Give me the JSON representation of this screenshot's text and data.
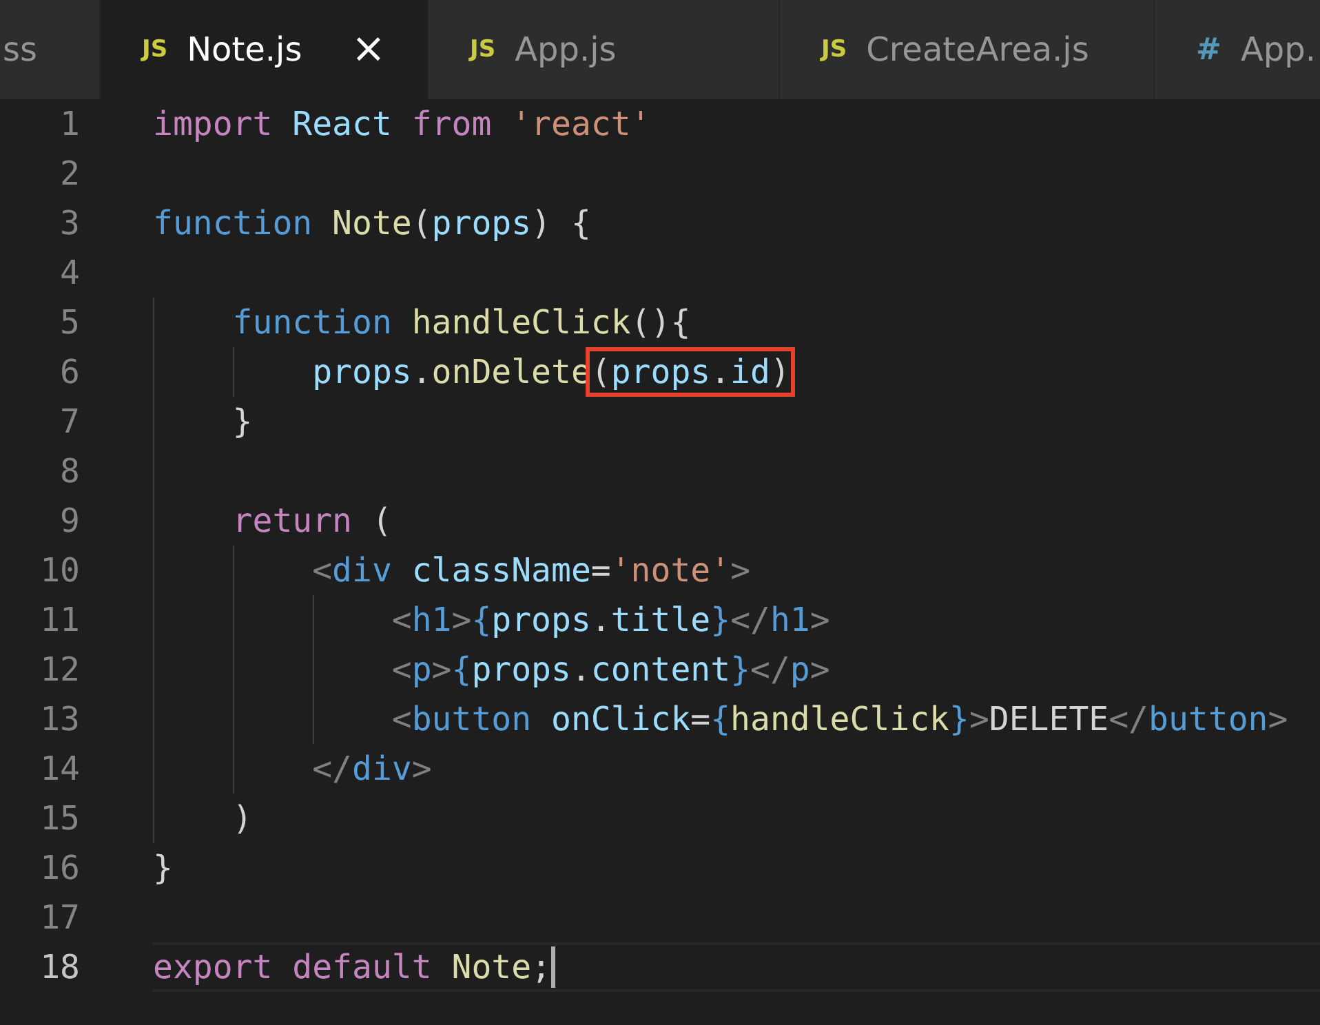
{
  "tabs": [
    {
      "label": "ss",
      "kind": "css",
      "selected": false
    },
    {
      "label": "Note.js",
      "kind": "js",
      "icon": "JS",
      "selected": true,
      "close": "×"
    },
    {
      "label": "App.js",
      "kind": "js",
      "icon": "JS",
      "selected": false
    },
    {
      "label": "CreateArea.js",
      "kind": "js",
      "icon": "JS",
      "selected": false
    },
    {
      "label": "App.",
      "kind": "css",
      "icon": "#",
      "selected": false
    }
  ],
  "editor": {
    "lines": [
      {
        "number": "1",
        "current": false,
        "tokens": [
          {
            "text": "import ",
            "kind": "keyword"
          },
          {
            "text": "React ",
            "kind": "variable"
          },
          {
            "text": "from ",
            "kind": "keyword"
          },
          {
            "text": "'react'",
            "kind": "string"
          }
        ]
      },
      {
        "number": "2",
        "current": false
      },
      {
        "number": "3",
        "current": false,
        "tokens": [
          {
            "text": "function ",
            "kind": "storage"
          },
          {
            "text": "Note",
            "kind": "function"
          },
          {
            "text": "(",
            "kind": "plain"
          },
          {
            "text": "props",
            "kind": "variable"
          },
          {
            "text": ") {",
            "kind": "plain"
          }
        ]
      },
      {
        "number": "4",
        "current": false
      },
      {
        "number": "5",
        "current": false,
        "tokens": [
          {
            "text": "    function ",
            "kind": "storage"
          },
          {
            "text": "handleClick",
            "kind": "function"
          },
          {
            "text": "(){",
            "kind": "plain"
          }
        ]
      },
      {
        "number": "6",
        "current": false,
        "tokens": [
          {
            "text": "        props",
            "kind": "variable"
          },
          {
            "text": ".",
            "kind": "plain"
          },
          {
            "text": "onDelete",
            "kind": "function"
          },
          {
            "kind": "annotation-box",
            "tokens": [
              {
                "text": "(",
                "kind": "plain"
              },
              {
                "text": "props",
                "kind": "variable"
              },
              {
                "text": ".",
                "kind": "plain"
              },
              {
                "text": "id",
                "kind": "variable"
              },
              {
                "text": ")",
                "kind": "plain"
              }
            ]
          }
        ]
      },
      {
        "number": "7",
        "current": false,
        "tokens": [
          {
            "text": "    }",
            "kind": "plain"
          }
        ]
      },
      {
        "number": "8",
        "current": false
      },
      {
        "number": "9",
        "current": false,
        "tokens": [
          {
            "text": "    return",
            "kind": "keyword"
          },
          {
            "text": " (",
            "kind": "plain"
          }
        ]
      },
      {
        "number": "10",
        "current": false,
        "tokens": [
          {
            "text": "        <",
            "kind": "bracket"
          },
          {
            "text": "div",
            "kind": "tag"
          },
          {
            "text": " className",
            "kind": "variable"
          },
          {
            "text": "=",
            "kind": "plain"
          },
          {
            "text": "'note'",
            "kind": "string"
          },
          {
            "text": ">",
            "kind": "bracket"
          }
        ]
      },
      {
        "number": "11",
        "current": false,
        "tokens": [
          {
            "text": "            <",
            "kind": "bracket"
          },
          {
            "text": "h1",
            "kind": "tag"
          },
          {
            "text": ">",
            "kind": "bracket"
          },
          {
            "text": "{",
            "kind": "tag"
          },
          {
            "text": "props",
            "kind": "variable"
          },
          {
            "text": ".",
            "kind": "plain"
          },
          {
            "text": "title",
            "kind": "variable"
          },
          {
            "text": "}",
            "kind": "tag"
          },
          {
            "text": "</",
            "kind": "bracket"
          },
          {
            "text": "h1",
            "kind": "tag"
          },
          {
            "text": ">",
            "kind": "bracket"
          }
        ]
      },
      {
        "number": "12",
        "current": false,
        "tokens": [
          {
            "text": "            <",
            "kind": "bracket"
          },
          {
            "text": "p",
            "kind": "tag"
          },
          {
            "text": ">",
            "kind": "bracket"
          },
          {
            "text": "{",
            "kind": "tag"
          },
          {
            "text": "props",
            "kind": "variable"
          },
          {
            "text": ".",
            "kind": "plain"
          },
          {
            "text": "content",
            "kind": "variable"
          },
          {
            "text": "}",
            "kind": "tag"
          },
          {
            "text": "</",
            "kind": "bracket"
          },
          {
            "text": "p",
            "kind": "tag"
          },
          {
            "text": ">",
            "kind": "bracket"
          }
        ]
      },
      {
        "number": "13",
        "current": false,
        "tokens": [
          {
            "text": "            <",
            "kind": "bracket"
          },
          {
            "text": "button",
            "kind": "tag"
          },
          {
            "text": " onClick",
            "kind": "variable"
          },
          {
            "text": "=",
            "kind": "plain"
          },
          {
            "text": "{",
            "kind": "tag"
          },
          {
            "text": "handleClick",
            "kind": "function"
          },
          {
            "text": "}",
            "kind": "tag"
          },
          {
            "text": ">",
            "kind": "bracket"
          },
          {
            "text": "DELETE",
            "kind": "plain"
          },
          {
            "text": "</",
            "kind": "bracket"
          },
          {
            "text": "button",
            "kind": "tag"
          },
          {
            "text": ">",
            "kind": "bracket"
          }
        ]
      },
      {
        "number": "14",
        "current": false,
        "tokens": [
          {
            "text": "        </",
            "kind": "bracket"
          },
          {
            "text": "div",
            "kind": "tag"
          },
          {
            "text": ">",
            "kind": "bracket"
          }
        ]
      },
      {
        "number": "15",
        "current": false,
        "tokens": [
          {
            "text": "    )",
            "kind": "plain"
          }
        ]
      },
      {
        "number": "16",
        "current": false,
        "tokens": [
          {
            "text": "}",
            "kind": "plain"
          }
        ]
      },
      {
        "number": "17",
        "current": false
      },
      {
        "number": "18",
        "current": true,
        "tokens": [
          {
            "text": "export ",
            "kind": "keyword"
          },
          {
            "text": "default ",
            "kind": "keyword"
          },
          {
            "text": "Note",
            "kind": "function"
          },
          {
            "text": ";",
            "kind": "plain"
          }
        ]
      }
    ]
  }
}
